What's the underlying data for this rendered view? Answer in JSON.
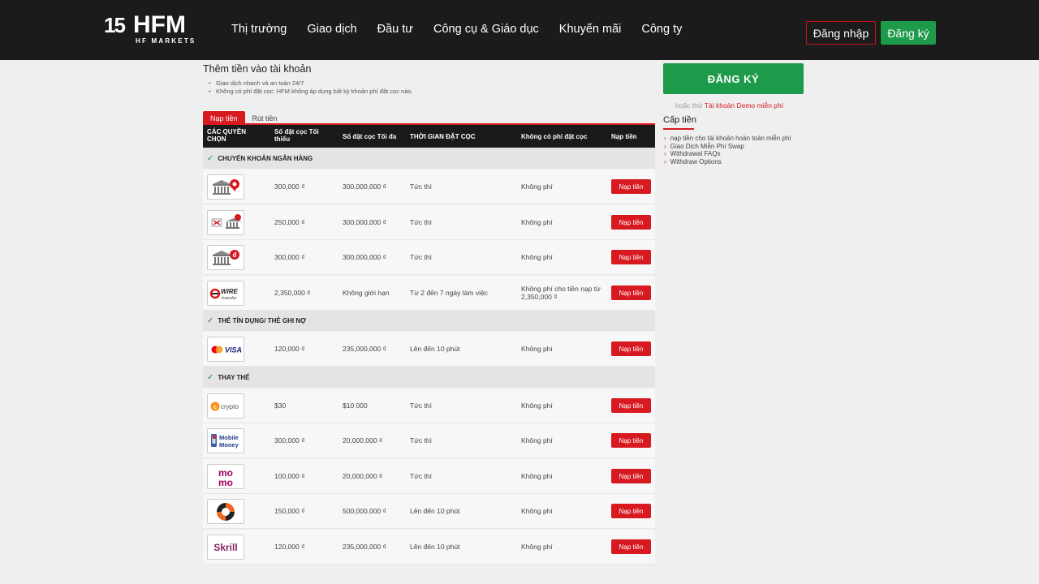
{
  "header": {
    "logo_num": "15",
    "logo_main": "HFM",
    "logo_sub": "HF MARKETS",
    "nav": [
      "Thị trường",
      "Giao dịch",
      "Đầu tư",
      "Công cụ & Giáo dục",
      "Khuyến mãi",
      "Công ty"
    ],
    "login": "Đăng nhập",
    "signup": "Đăng ký"
  },
  "page": {
    "title": "Thêm tiền vào tài khoản",
    "bullets": [
      "Giao dịch nhanh và an toàn 24/7",
      "Không có phí đặt cọc:  HFM không áp dụng bất kỳ khoản phí đặt cọc nào."
    ],
    "tab_deposit": "Nạp tiền",
    "tab_withdraw": "Rút tiền"
  },
  "table": {
    "headers": [
      "CÁC QUYỀN CHỌN",
      "Số đặt cọc Tối thiểu",
      "Số đặt cọc Tối đa",
      "THỜI GIAN ĐẶT CỌC",
      "Không có phí đặt cọc",
      "Nạp tiền"
    ],
    "sections": [
      "CHUYỂN KHOẢN NGÂN HÀNG",
      "THẺ TÍN DỤNG/ THẺ GHI NỢ",
      "THAY THẾ"
    ],
    "rows": [
      {
        "icon": "bank-pin-icon",
        "min": "300,000 ₫",
        "max": "300,000,000 ₫",
        "time": "Tức thì",
        "fee": "Không phí",
        "action": "Nạp tiền"
      },
      {
        "icon": "bank-transfer-icon",
        "min": "250,000 ₫",
        "max": "300,000,000 ₫",
        "time": "Tức thì",
        "fee": "Không phí",
        "action": "Nạp tiền"
      },
      {
        "icon": "bank-dong-icon",
        "min": "300,000 ₫",
        "max": "300,000,000 ₫",
        "time": "Tức thì",
        "fee": "Không phí",
        "action": "Nạp tiền"
      },
      {
        "icon": "wire-transfer-icon",
        "icon_text": "WIRE",
        "icon_sub": "transfer",
        "min": "2,350,000 ₫",
        "max": "Không giới hạn",
        "time": "Từ 2 đến 7 ngày làm việc",
        "fee": "Không phí cho tiền nạp từ 2,350,000 ₫",
        "action": "Nạp tiền"
      },
      {
        "icon": "mastercard-visa-icon",
        "icon_text": "VISA",
        "min": "120,000 ₫",
        "max": "235,000,000 ₫",
        "time": "Lên đến 10 phút",
        "fee": "Không phí",
        "action": "Nạp tiền"
      },
      {
        "icon": "crypto-icon",
        "icon_text": "crypto",
        "min": "$30",
        "max": "$10 000",
        "time": "Tức thì",
        "fee": "Không phí",
        "action": "Nạp tiền"
      },
      {
        "icon": "mobile-money-icon",
        "icon_text": "Mobile",
        "icon_sub": "Money",
        "min": "300,000 ₫",
        "max": "20,000,000 ₫",
        "time": "Tức thì",
        "fee": "Không phí",
        "action": "Nạp tiền"
      },
      {
        "icon": "momo-icon",
        "icon_text": "mo",
        "icon_sub": "mo",
        "min": "100,000 ₫",
        "max": "20,000,000 ₫",
        "time": "Tức thì",
        "fee": "Không phí",
        "action": "Nạp tiền"
      },
      {
        "icon": "swirl-payment-icon",
        "min": "150,000 ₫",
        "max": "500,000,000 ₫",
        "time": "Lên đến 10 phút",
        "fee": "Không phí",
        "action": "Nạp tiền"
      },
      {
        "icon": "skrill-icon",
        "icon_text": "Skrill",
        "min": "120,000 ₫",
        "max": "235,000,000 ₫",
        "time": "Lên đến 10 phút",
        "fee": "Không phí",
        "action": "Nạp tiền"
      }
    ]
  },
  "sidebar": {
    "signup_big": "ĐĂNG KÝ",
    "demo_prefix": "hoặc thử",
    "demo_link": "Tài khoản Demo miễn phí",
    "funding_title": "Cấp tiền",
    "links": [
      "nạp tiền cho tài khoản hoàn toàn miễn phí",
      "Giao Dịch Miễn Phí Swap",
      "Withdrawal FAQs",
      "Withdraw Options"
    ]
  },
  "colors": {
    "brand_red": "#d71920",
    "brand_green": "#1e9b4a",
    "header_bg": "#1b1b1b"
  }
}
